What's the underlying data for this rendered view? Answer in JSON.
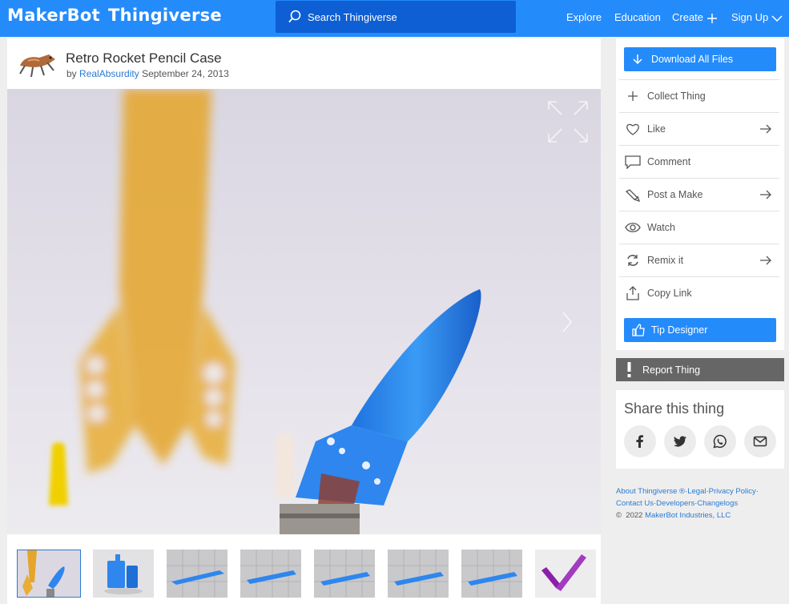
{
  "header": {
    "logo_left": "MakerBot",
    "logo_right": "Thingiverse",
    "search_placeholder": "Search Thingiverse",
    "nav": {
      "explore": "Explore",
      "education": "Education",
      "create": "Create",
      "sign_up": "Sign Up"
    }
  },
  "thing": {
    "title": "Retro Rocket Pencil Case",
    "by": "by",
    "author": "RealAbsurdity",
    "date": "September 24, 2013"
  },
  "gallery": {
    "thumbnail_count": 8,
    "active_index": 0
  },
  "actions": {
    "download": "Download All Files",
    "collect": "Collect Thing",
    "like": "Like",
    "comment": "Comment",
    "post_make": "Post a Make",
    "watch": "Watch",
    "remix": "Remix it",
    "copy_link": "Copy Link",
    "tip": "Tip Designer"
  },
  "report": "Report Thing",
  "share": {
    "heading": "Share this thing",
    "icons": [
      "facebook-icon",
      "twitter-icon",
      "whatsapp-icon",
      "email-icon"
    ]
  },
  "footer": {
    "about": "About Thingiverse ®",
    "sep": "·",
    "legal": "Legal",
    "privacy": "Privacy Policy",
    "contact": "Contact Us",
    "developers": "Developers",
    "changelogs": "Changelogs",
    "copyright_symbol": "©",
    "year": "2022",
    "company": "MakerBot Industries, LLC"
  },
  "colors": {
    "brand_blue": "#248bfb",
    "search_bg": "#0d5fd3",
    "report_bg": "#666666",
    "link": "#2a7bd1"
  }
}
